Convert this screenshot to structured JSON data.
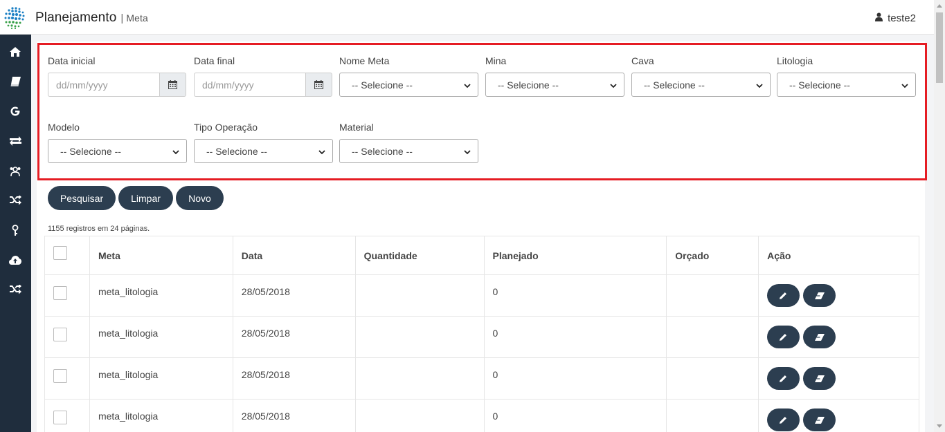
{
  "header": {
    "title": "Planejamento",
    "separator": "|",
    "subtitle": "Meta",
    "user": "teste2"
  },
  "sidebar": {
    "items": [
      {
        "icon": "home-icon"
      },
      {
        "icon": "book-icon"
      },
      {
        "icon": "google-icon"
      },
      {
        "icon": "exchange-icon"
      },
      {
        "icon": "users-icon"
      },
      {
        "icon": "shuffle-icon"
      },
      {
        "icon": "key-icon"
      },
      {
        "icon": "cloud-upload-icon"
      },
      {
        "icon": "random-icon"
      }
    ]
  },
  "filters": {
    "data_inicial": {
      "label": "Data inicial",
      "placeholder": "dd/mm/yyyy"
    },
    "data_final": {
      "label": "Data final",
      "placeholder": "dd/mm/yyyy"
    },
    "nome_meta": {
      "label": "Nome Meta",
      "value": "-- Selecione --"
    },
    "mina": {
      "label": "Mina",
      "value": "-- Selecione --"
    },
    "cava": {
      "label": "Cava",
      "value": "-- Selecione --"
    },
    "litologia": {
      "label": "Litologia",
      "value": "-- Selecione --"
    },
    "modelo": {
      "label": "Modelo",
      "value": "-- Selecione --"
    },
    "tipo_operacao": {
      "label": "Tipo Operação",
      "value": "-- Selecione --"
    },
    "material": {
      "label": "Material",
      "value": "-- Selecione --"
    }
  },
  "actions": {
    "pesquisar": "Pesquisar",
    "limpar": "Limpar",
    "novo": "Novo"
  },
  "records_info": "1155 registros em 24 páginas.",
  "table": {
    "headers": [
      "Meta",
      "Data",
      "Quantidade",
      "Planejado",
      "Orçado",
      "Ação"
    ],
    "rows": [
      {
        "meta": "meta_litologia",
        "data": "28/05/2018",
        "quantidade": "",
        "planejado": "0",
        "orcado": ""
      },
      {
        "meta": "meta_litologia",
        "data": "28/05/2018",
        "quantidade": "",
        "planejado": "0",
        "orcado": ""
      },
      {
        "meta": "meta_litologia",
        "data": "28/05/2018",
        "quantidade": "",
        "planejado": "0",
        "orcado": ""
      },
      {
        "meta": "meta_litologia",
        "data": "28/05/2018",
        "quantidade": "",
        "planejado": "0",
        "orcado": ""
      }
    ]
  },
  "colors": {
    "sidebar": "#1f2d3d",
    "button": "#2c3e50",
    "highlight": "#e51c23"
  }
}
